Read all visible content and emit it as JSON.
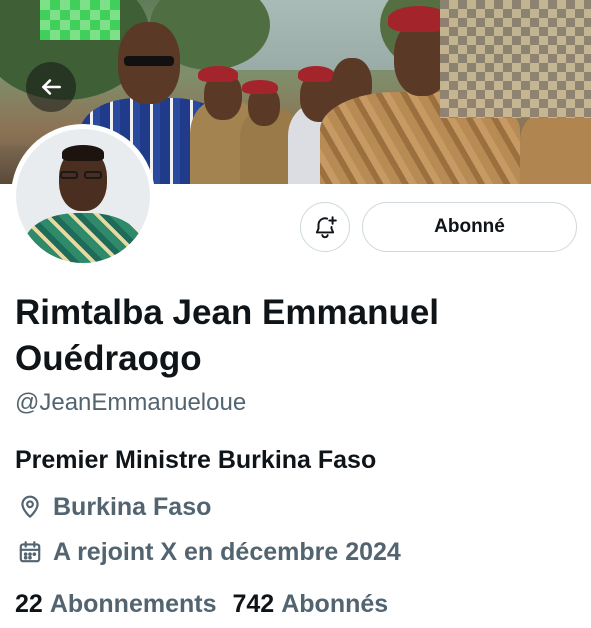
{
  "header": {
    "back_icon": "arrow-left-icon"
  },
  "profile": {
    "display_name": "Rimtalba Jean Emmanuel Ouédraogo",
    "handle": "@JeanEmmanueloue",
    "bio": "Premier Ministre Burkina Faso",
    "location": "Burkina Faso",
    "joined": "A rejoint X en décembre 2024"
  },
  "actions": {
    "notify_icon": "bell-plus-icon",
    "follow_label": "Abonné"
  },
  "stats": {
    "following_count": "22",
    "following_label": "Abonnements",
    "followers_count": "742",
    "followers_label": "Abonnés"
  },
  "colors": {
    "text_primary": "#0f1419",
    "text_secondary": "#536471",
    "border": "#cfd9de"
  }
}
